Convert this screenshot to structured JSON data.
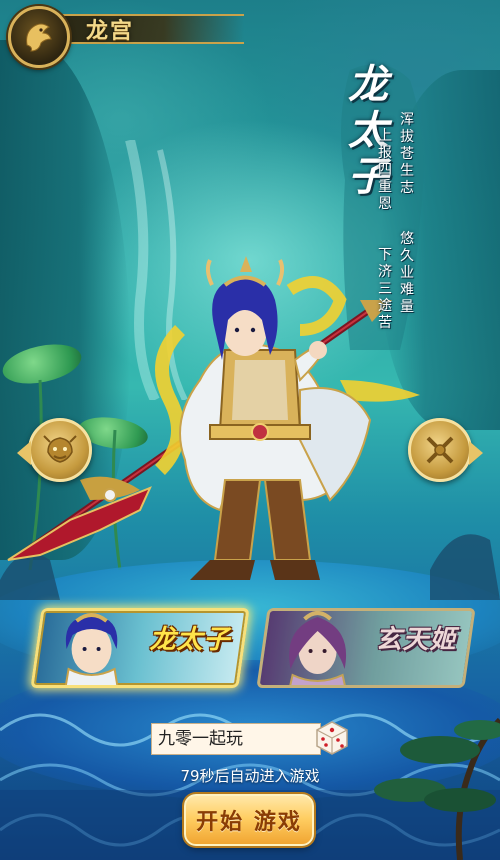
{
  "header": {
    "title": "龙宫",
    "emblem_icon": "golden-dragon-emblem-icon"
  },
  "character": {
    "name": "龙太子",
    "name_chars": [
      "龙",
      "太",
      "子"
    ],
    "poem_columns": [
      [
        "浑",
        "拔",
        "苍",
        "生",
        "志",
        "",
        "",
        "悠",
        "久",
        "业",
        "难",
        "量"
      ],
      [
        "上",
        "报",
        "四",
        "重",
        "恩",
        "",
        "",
        "下",
        "济",
        "三",
        "途",
        "苦"
      ]
    ]
  },
  "nav": {
    "left_icon": "dragon-head-arrow-left-icon",
    "right_icon": "crossed-weapons-arrow-right-icon"
  },
  "cards": [
    {
      "label": "龙太子",
      "selected": true
    },
    {
      "label": "玄天姬",
      "selected": false
    }
  ],
  "form": {
    "name_value": "九零一起玩",
    "dice_icon": "dice-icon",
    "countdown_text": "79秒后自动进入游戏",
    "start_label": "开始 游戏"
  },
  "colors": {
    "gold": "#f3d98a",
    "selected_label": "#ffe44a",
    "start_button": "#ffcf64"
  }
}
